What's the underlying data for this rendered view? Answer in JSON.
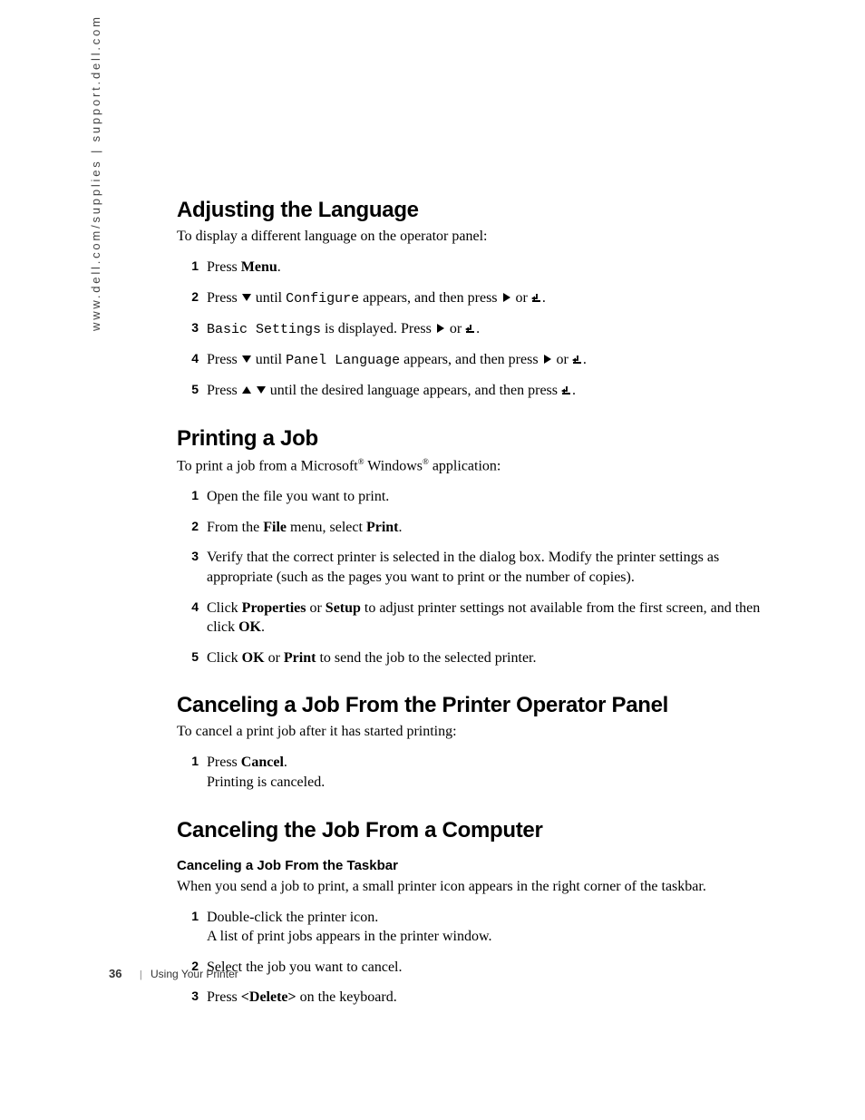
{
  "side_text": "www.dell.com/supplies | support.dell.com",
  "footer": {
    "page_number": "36",
    "section": "Using Your Printer"
  },
  "icons": {
    "down": "down-triangle-icon",
    "right": "right-triangle-icon",
    "up": "up-triangle-icon",
    "enter": "enter-icon"
  },
  "sections": [
    {
      "heading": "Adjusting the Language",
      "intro": "To display a different language on the operator panel:",
      "steps": [
        {
          "n": "1",
          "html": "Press <span class='bold'>Menu</span>."
        },
        {
          "n": "2",
          "html": "Press {down} until <span class='mono'>Configure</span> appears, and then press {right} or {enter}."
        },
        {
          "n": "3",
          "html": "<span class='mono'>Basic Settings</span> is displayed. Press {right} or {enter}."
        },
        {
          "n": "4",
          "html": "Press {down} until <span class='mono'>Panel Language</span> appears, and then press {right} or {enter}."
        },
        {
          "n": "5",
          "html": "Press {up} {down} until the desired language appears, and then press {enter}."
        }
      ]
    },
    {
      "heading": "Printing a Job",
      "intro_html": "To print a job from a Microsoft<span class='sup'>®</span> Windows<span class='sup'>®</span> application:",
      "steps": [
        {
          "n": "1",
          "html": "Open the file you want to print."
        },
        {
          "n": "2",
          "html": "From the <span class='bold'>File</span> menu, select <span class='bold'>Print</span>."
        },
        {
          "n": "3",
          "html": "Verify that the correct printer is selected in the dialog box. Modify the printer settings as appropriate (such as the pages you want to print or the number of copies)."
        },
        {
          "n": "4",
          "html": "Click <span class='bold'>Properties</span> or <span class='bold'>Setup</span> to adjust printer settings not available from the first screen, and then click <span class='bold'>OK</span>."
        },
        {
          "n": "5",
          "html": "Click <span class='bold'>OK</span> or <span class='bold'>Print</span> to send the job to the selected printer."
        }
      ]
    },
    {
      "heading": "Canceling a Job From the Printer Operator Panel",
      "intro": "To cancel a print job after it has started printing:",
      "steps": [
        {
          "n": "1",
          "html": "Press <span class='bold'>Cancel</span>.<span class='sub'>Printing is canceled.</span>"
        }
      ]
    },
    {
      "heading": "Canceling the Job From a Computer",
      "subheading": "Canceling a Job From the Taskbar",
      "intro": "When you send a job to print, a small printer icon appears in the right corner of the taskbar.",
      "steps": [
        {
          "n": "1",
          "html": "Double-click the printer icon.<span class='sub'>A list of print jobs appears in the printer window.</span>"
        },
        {
          "n": "2",
          "html": "Select the job you want to cancel."
        },
        {
          "n": "3",
          "html": "Press <span class='bold'>&lt;Delete&gt;</span> on the keyboard."
        }
      ]
    }
  ]
}
